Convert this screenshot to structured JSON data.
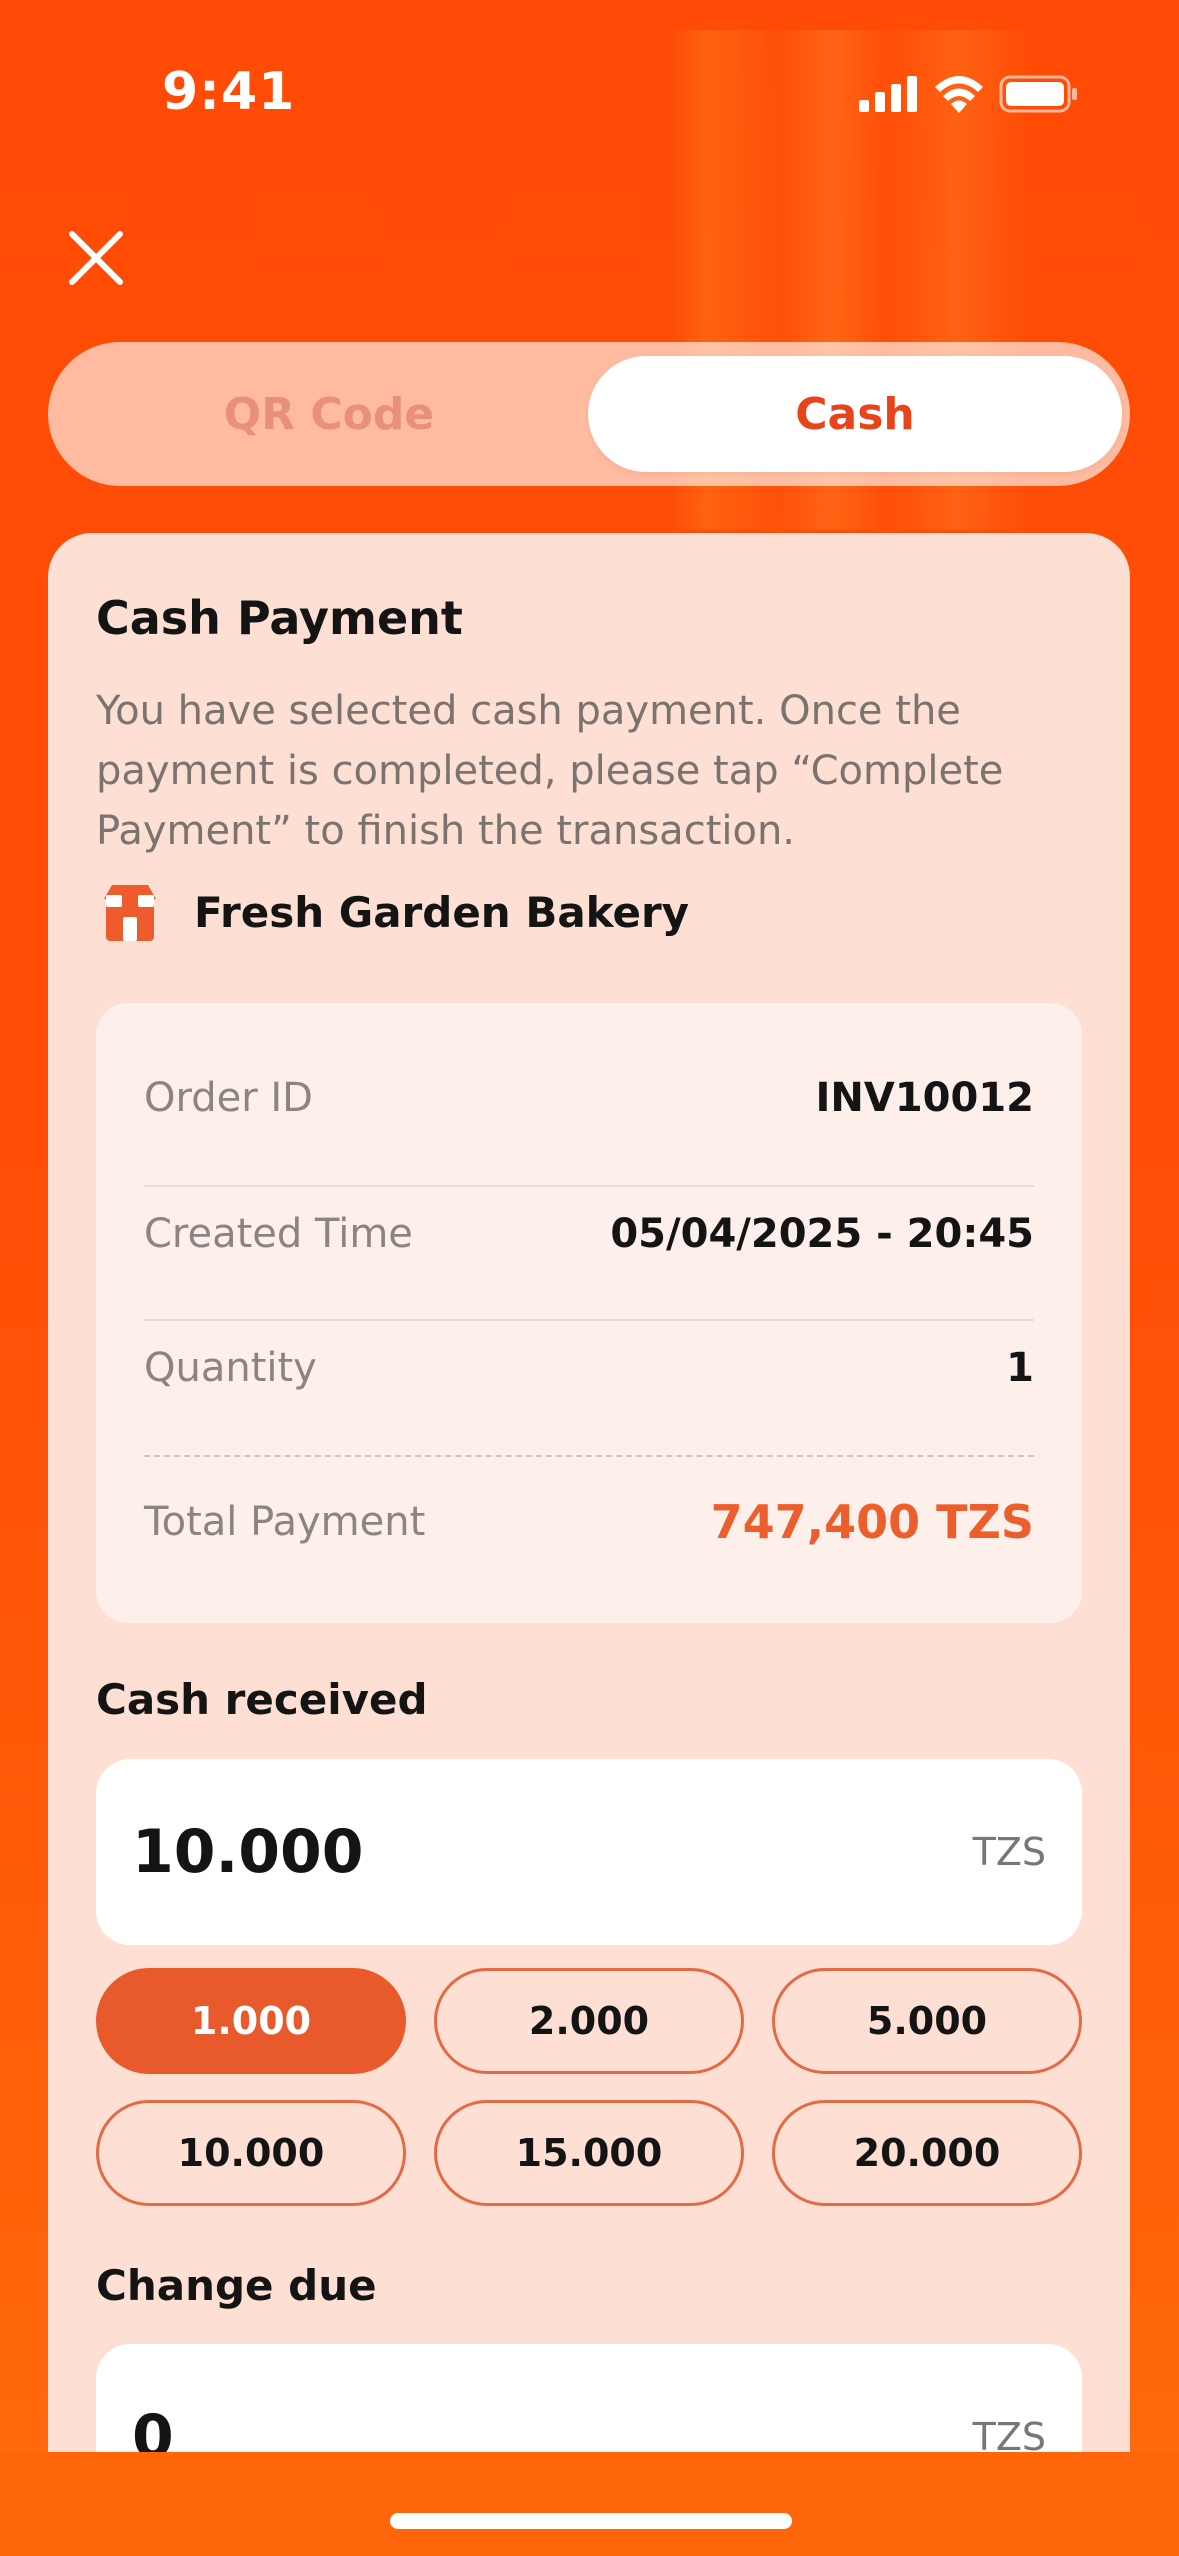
{
  "status_bar": {
    "time": "9:41"
  },
  "header": {
    "close_icon": "close-icon"
  },
  "tabs": [
    {
      "label": "QR Code",
      "selected": false
    },
    {
      "label": "Cash",
      "selected": true
    }
  ],
  "card": {
    "title": "Cash Payment",
    "description": "You have selected cash payment. Once the payment is completed, please tap “Complete Payment” to finish the transaction.",
    "merchant": {
      "icon": "shop-icon",
      "name": "Fresh Garden Bakery"
    }
  },
  "details": {
    "order_id": {
      "label": "Order ID",
      "value": "INV10012"
    },
    "created_time": {
      "label": "Created Time",
      "value": "05/04/2025 - 20:45"
    },
    "quantity": {
      "label": "Quantity",
      "value": "1"
    },
    "total": {
      "label": "Total Payment",
      "value": "747,400 TZS"
    }
  },
  "cash_received": {
    "label": "Cash received",
    "value": "10.000",
    "unit": "TZS",
    "quick_amounts": [
      "1.000",
      "2.000",
      "5.000",
      "10.000",
      "15.000",
      "20.000"
    ],
    "selected_index": 0
  },
  "change_due": {
    "label": "Change due",
    "value": "0",
    "unit": "TZS"
  },
  "colors": {
    "primary": "#ff4b05",
    "accent": "#e85a2c",
    "total": "#ec5f2c"
  }
}
